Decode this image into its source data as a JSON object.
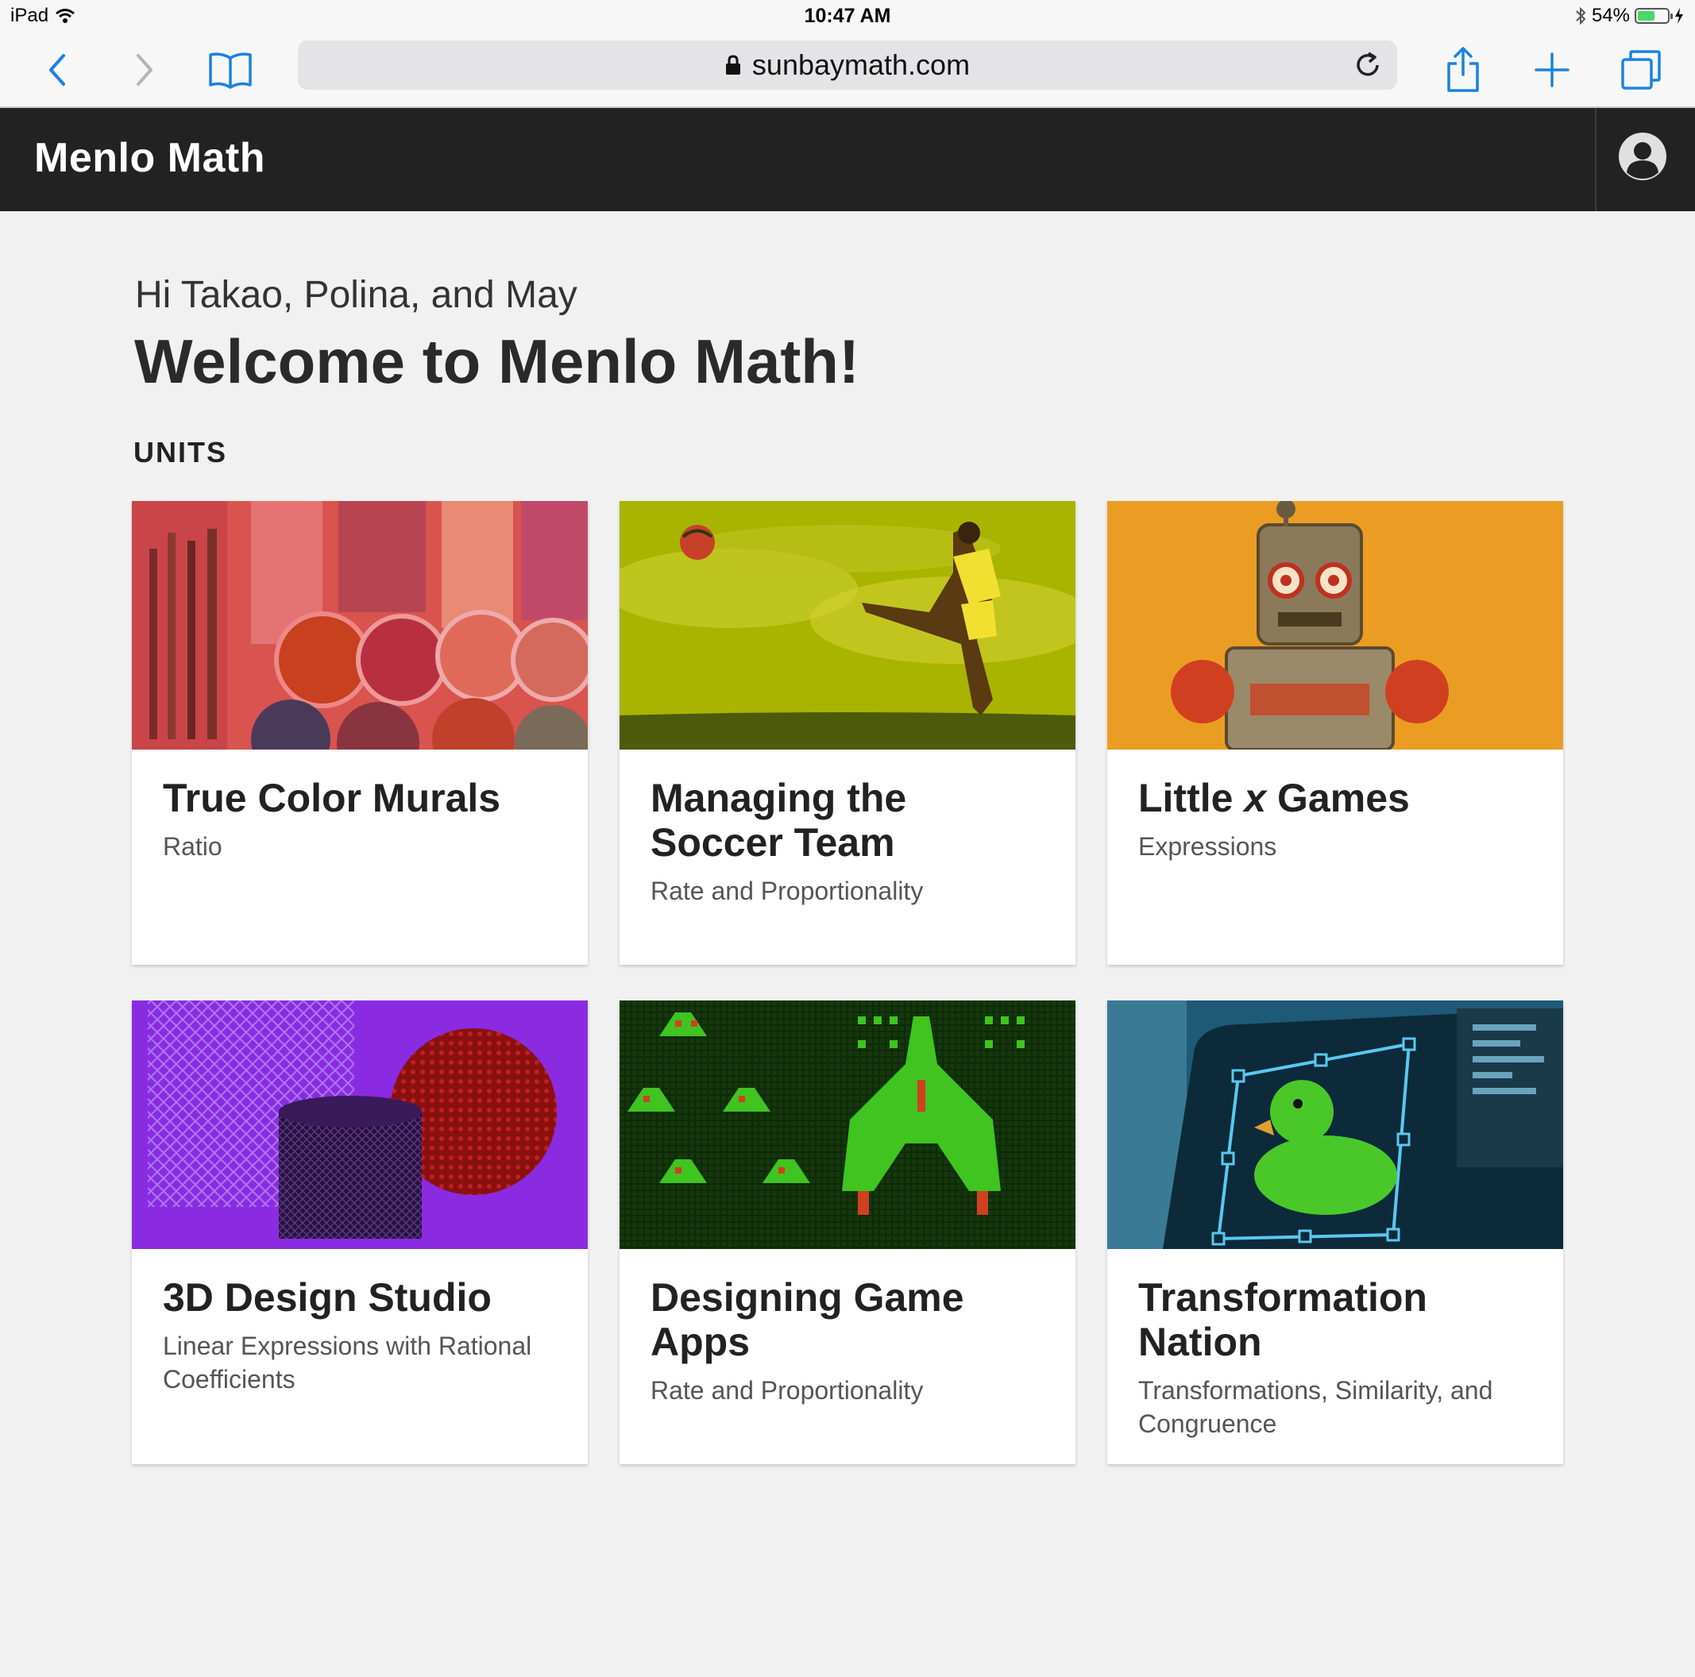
{
  "status_bar": {
    "device": "iPad",
    "time": "10:47 AM",
    "battery": "54%"
  },
  "browser": {
    "url": "sunbaymath.com"
  },
  "header": {
    "app_title": "Menlo Math"
  },
  "welcome": {
    "greeting": "Hi Takao, Polina, and May",
    "heading": "Welcome to Menlo Math!",
    "section_label": "UNITS"
  },
  "units": [
    {
      "title": "True Color Murals",
      "subtitle": "Ratio",
      "color": "#d9534f"
    },
    {
      "title": "Managing the Soccer Team",
      "subtitle": "Rate and Proportionality",
      "color": "#a6b400"
    },
    {
      "title_pre": "Little ",
      "title_var": "x",
      "title_post": " Games",
      "subtitle": "Expressions",
      "color": "#e8961c"
    },
    {
      "title": "3D Design Studio",
      "subtitle": "Linear Expressions with Rational Coefficients",
      "color": "#8a2be2"
    },
    {
      "title": "Designing Game Apps",
      "subtitle": "Rate and Proportionality",
      "color": "#2e8b1e"
    },
    {
      "title": "Transformation Nation",
      "subtitle": "Transformations, Similarity, and Congruence",
      "color": "#1e88b4"
    }
  ]
}
